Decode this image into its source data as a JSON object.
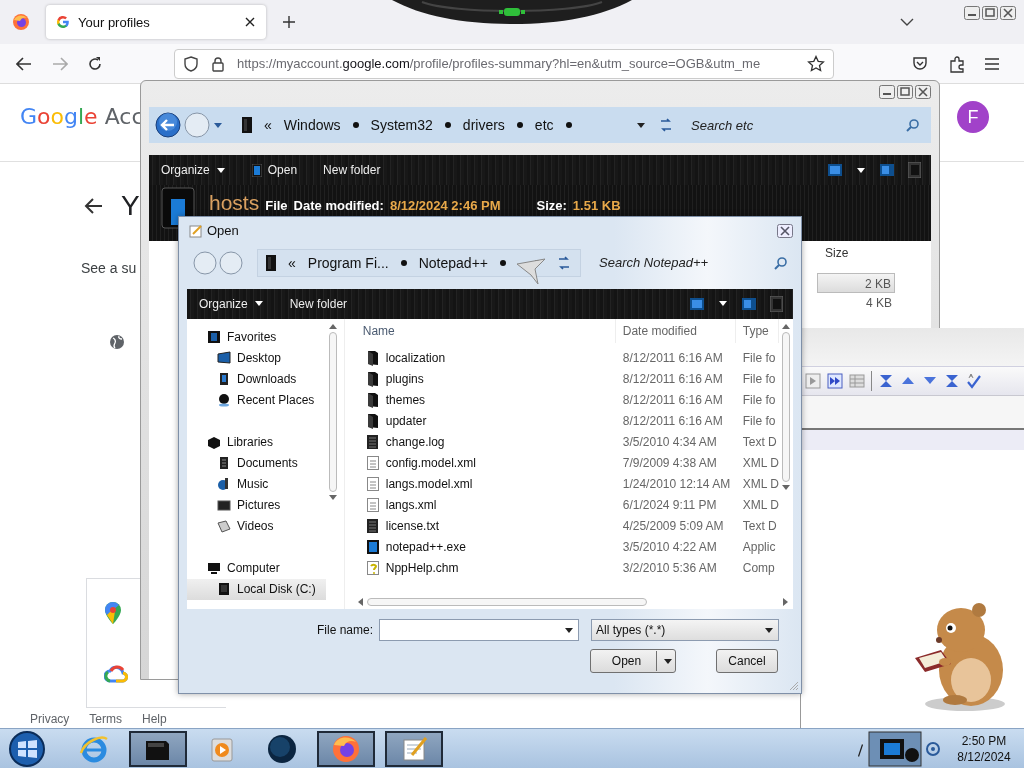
{
  "browser": {
    "tabs": [
      {
        "title": "Your profiles",
        "selected": true
      }
    ],
    "url": {
      "scheme": "https://myaccount.",
      "domain": "google.com",
      "path": "/profile/profiles-summary?hl=en&utm_source=OGB&utm_me"
    },
    "page": {
      "logo": "Google Acc",
      "heading": "Y",
      "subtitle": "See a su",
      "avatar": "F",
      "footer_links": [
        "Privacy",
        "Terms",
        "Help"
      ]
    }
  },
  "explorer": {
    "breadcrumb": [
      "Windows",
      "System32",
      "drivers",
      "etc"
    ],
    "search_placeholder": "Search etc",
    "toolbar": [
      {
        "label": "Organize",
        "kind": "menu"
      },
      {
        "label": "Open",
        "kind": "open"
      },
      {
        "label": "New folder",
        "kind": "plain"
      }
    ],
    "details": {
      "name": "hosts",
      "type": "File",
      "date_label": "Date modified:",
      "date": "8/12/2024 2:46 PM",
      "size_label": "Size:",
      "size": "1.51 KB"
    },
    "size_column": "Size",
    "sizes": [
      {
        "text": "2 KB",
        "selected": true
      },
      {
        "text": "4 KB",
        "selected": false
      }
    ]
  },
  "dialog": {
    "title": "Open",
    "overflow_mark": "«",
    "breadcrumb": [
      "Program Fi...",
      "Notepad++"
    ],
    "search_placeholder": "Search Notepad++",
    "toolbar": [
      {
        "label": "Organize",
        "kind": "menu"
      },
      {
        "label": "New folder",
        "kind": "plain"
      }
    ],
    "nav": [
      {
        "label": "Favorites",
        "kind": "star",
        "selected": false,
        "children": [
          {
            "label": "Desktop",
            "kind": "desktop",
            "selected": false
          },
          {
            "label": "Downloads",
            "kind": "download",
            "selected": false
          },
          {
            "label": "Recent Places",
            "kind": "recent",
            "selected": false
          }
        ]
      },
      {
        "label": "Libraries",
        "kind": "library",
        "selected": false,
        "children": [
          {
            "label": "Documents",
            "kind": "document",
            "selected": false
          },
          {
            "label": "Music",
            "kind": "music",
            "selected": false
          },
          {
            "label": "Pictures",
            "kind": "picture",
            "selected": false
          },
          {
            "label": "Videos",
            "kind": "video",
            "selected": false
          }
        ]
      },
      {
        "label": "Computer",
        "kind": "computer",
        "selected": false,
        "children": [
          {
            "label": "Local Disk (C:)",
            "kind": "disk",
            "selected": true
          }
        ]
      }
    ],
    "columns": [
      "Name",
      "Date modified",
      "Type"
    ],
    "files": [
      {
        "name": "localization",
        "date": "8/12/2011 6:16 AM",
        "type": "File fo",
        "kind": "folder"
      },
      {
        "name": "plugins",
        "date": "8/12/2011 6:16 AM",
        "type": "File fo",
        "kind": "folder"
      },
      {
        "name": "themes",
        "date": "8/12/2011 6:16 AM",
        "type": "File fo",
        "kind": "folder"
      },
      {
        "name": "updater",
        "date": "8/12/2011 6:16 AM",
        "type": "File fo",
        "kind": "folder"
      },
      {
        "name": "change.log",
        "date": "3/5/2010 4:34 AM",
        "type": "Text D",
        "kind": "text"
      },
      {
        "name": "config.model.xml",
        "date": "7/9/2009 4:38 AM",
        "type": "XML D",
        "kind": "xml"
      },
      {
        "name": "langs.model.xml",
        "date": "1/24/2010 12:14 AM",
        "type": "XML D",
        "kind": "xml"
      },
      {
        "name": "langs.xml",
        "date": "6/1/2024 9:11 PM",
        "type": "XML D",
        "kind": "xml"
      },
      {
        "name": "license.txt",
        "date": "4/25/2009 5:09 AM",
        "type": "Text D",
        "kind": "text"
      },
      {
        "name": "notepad++.exe",
        "date": "3/5/2010 4:22 AM",
        "type": "Applic",
        "kind": "exe"
      },
      {
        "name": "NppHelp.chm",
        "date": "3/2/2010 5:36 AM",
        "type": "Comp",
        "kind": "help"
      }
    ],
    "file_name_label": "File name:",
    "file_type": "All types (*.*)",
    "buttons": [
      {
        "label": "Open",
        "kind": "split"
      },
      {
        "label": "Cancel",
        "kind": "plain"
      }
    ]
  },
  "taskbar": {
    "apps": [
      {
        "kind": "ie",
        "active": false
      },
      {
        "kind": "explorer",
        "active": true
      },
      {
        "kind": "media",
        "active": false
      },
      {
        "kind": "globe",
        "active": false
      },
      {
        "kind": "firefox",
        "active": true
      },
      {
        "kind": "notepad",
        "active": true
      }
    ],
    "time": "2:50 PM",
    "date": "8/12/2024"
  }
}
